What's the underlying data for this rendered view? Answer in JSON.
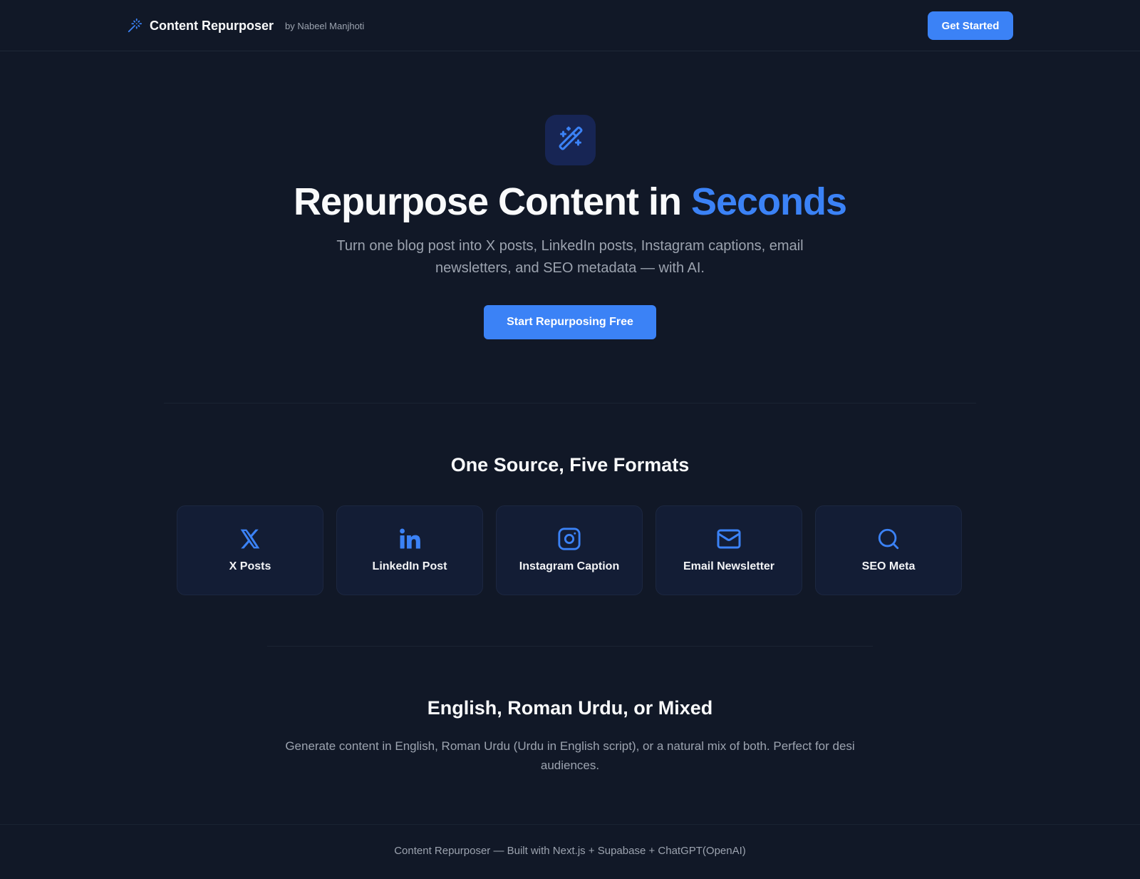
{
  "header": {
    "brand_name": "Content Repurposer",
    "brand_by": "by Nabeel Manjhoti",
    "brand_icon": "magic-wand-icon",
    "cta_label": "Get Started"
  },
  "hero": {
    "icon": "magic-wand-icon",
    "title_main": "Repurpose Content in ",
    "title_accent": "Seconds",
    "subtitle": "Turn one blog post into X posts, LinkedIn posts, Instagram captions, email newsletters, and SEO metadata — with AI.",
    "cta_label": "Start Repurposing Free"
  },
  "formats": {
    "title": "One Source, Five Formats",
    "items": [
      {
        "label": "X Posts",
        "icon": "x-logo-icon"
      },
      {
        "label": "LinkedIn Post",
        "icon": "linkedin-icon"
      },
      {
        "label": "Instagram Caption",
        "icon": "instagram-icon"
      },
      {
        "label": "Email Newsletter",
        "icon": "mail-icon"
      },
      {
        "label": "SEO Meta",
        "icon": "search-icon"
      }
    ]
  },
  "languages": {
    "title": "English, Roman Urdu, or Mixed",
    "subtitle": "Generate content in English, Roman Urdu (Urdu in English script), or a natural mix of both. Perfect for desi audiences."
  },
  "footer": {
    "text": "Content Repurposer — Built with Next.js + Supabase + ChatGPT(OpenAI)"
  },
  "colors": {
    "background": "#111827",
    "accent": "#3b82f6",
    "card": "#131d35",
    "muted_text": "#9ca3af"
  }
}
